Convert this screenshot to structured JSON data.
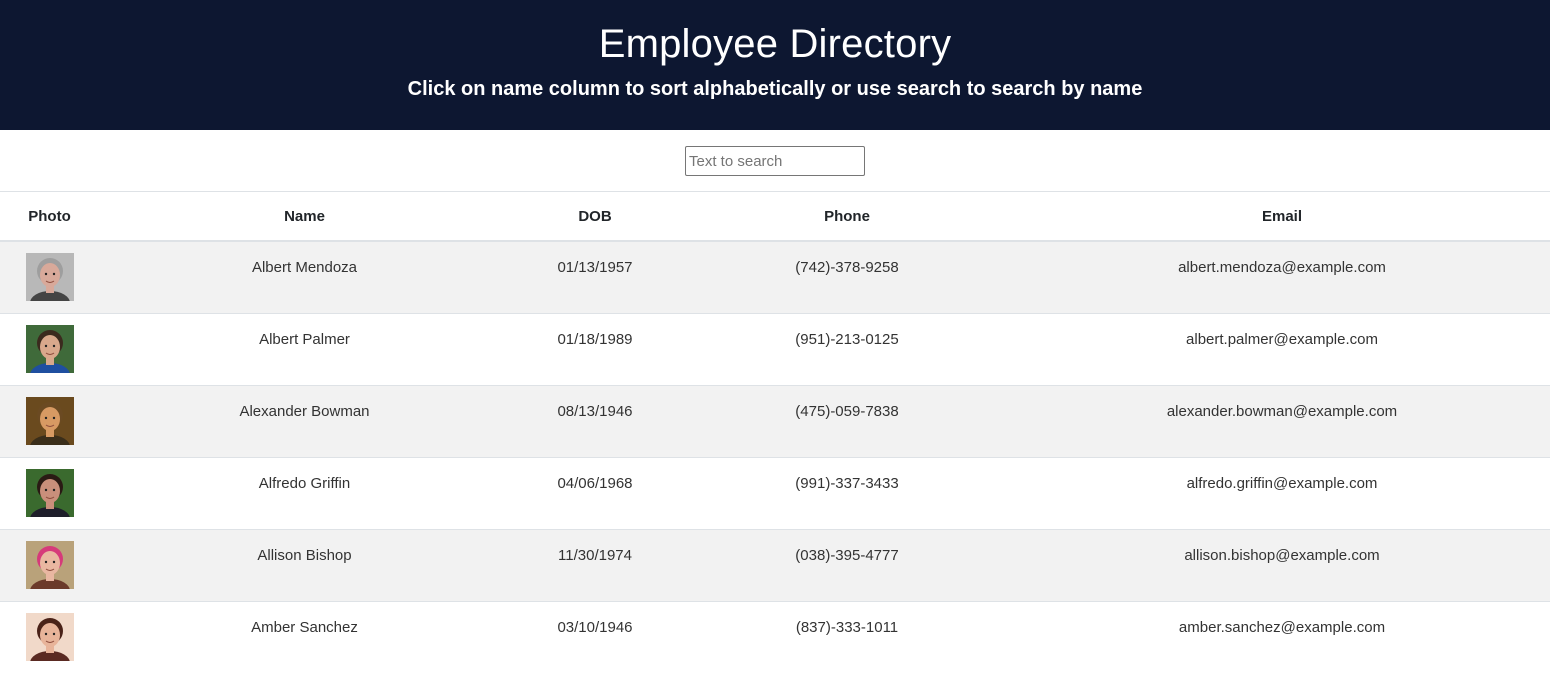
{
  "header": {
    "title": "Employee Directory",
    "subtitle": "Click on name column to sort alphabetically or use search to search by name"
  },
  "search": {
    "placeholder": "Text to search",
    "value": ""
  },
  "table": {
    "columns": [
      "Photo",
      "Name",
      "DOB",
      "Phone",
      "Email"
    ],
    "rows": [
      {
        "photo": "avatar-photo",
        "name": "Albert Mendoza",
        "dob": "01/13/1957",
        "phone": "(742)-378-9258",
        "email": "albert.mendoza@example.com",
        "skin": "#d8a99a",
        "hair": "#9e9e9e",
        "bg": "#b8b8b8",
        "shirt": "#444444"
      },
      {
        "photo": "avatar-photo",
        "name": "Albert Palmer",
        "dob": "01/18/1989",
        "phone": "(951)-213-0125",
        "email": "albert.palmer@example.com",
        "skin": "#d9a88c",
        "hair": "#3b2a1e",
        "bg": "#3f6a3a",
        "shirt": "#1f4fa0"
      },
      {
        "photo": "avatar-photo",
        "name": "Alexander Bowman",
        "dob": "08/13/1946",
        "phone": "(475)-059-7838",
        "email": "alexander.bowman@example.com",
        "skin": "#d79a63",
        "hair": "#6b4a22",
        "bg": "#6a4a1e",
        "shirt": "#3a2e1a"
      },
      {
        "photo": "avatar-photo",
        "name": "Alfredo Griffin",
        "dob": "04/06/1968",
        "phone": "(991)-337-3433",
        "email": "alfredo.griffin@example.com",
        "skin": "#c98f7b",
        "hair": "#2a1a14",
        "bg": "#3a6a2e",
        "shirt": "#1e1e2a"
      },
      {
        "photo": "avatar-photo",
        "name": "Allison Bishop",
        "dob": "11/30/1974",
        "phone": "(038)-395-4777",
        "email": "allison.bishop@example.com",
        "skin": "#e9b7a1",
        "hair": "#d63a7a",
        "bg": "#b9a27a",
        "shirt": "#6b3a2a"
      },
      {
        "photo": "avatar-photo",
        "name": "Amber Sanchez",
        "dob": "03/10/1946",
        "phone": "(837)-333-1011",
        "email": "amber.sanchez@example.com",
        "skin": "#e8b49a",
        "hair": "#4a2218",
        "bg": "#f1d9c9",
        "shirt": "#5a2a22"
      }
    ]
  },
  "colors": {
    "header_bg": "#0d1731",
    "stripe_bg": "#f2f2f2",
    "border": "#dee2e6"
  }
}
